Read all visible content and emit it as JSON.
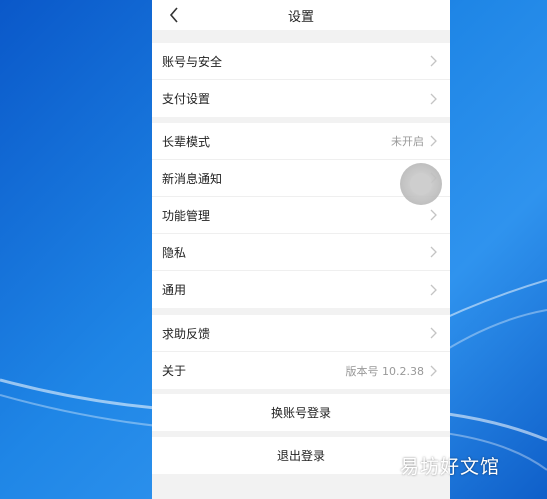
{
  "header": {
    "title": "设置"
  },
  "groups": [
    {
      "items": [
        {
          "label": "账号与安全",
          "value": ""
        },
        {
          "label": "支付设置",
          "value": ""
        }
      ]
    },
    {
      "items": [
        {
          "label": "长辈模式",
          "value": "未开启"
        },
        {
          "label": "新消息通知",
          "value": ""
        },
        {
          "label": "功能管理",
          "value": ""
        },
        {
          "label": "隐私",
          "value": ""
        },
        {
          "label": "通用",
          "value": ""
        }
      ]
    },
    {
      "items": [
        {
          "label": "求助反馈",
          "value": ""
        },
        {
          "label": "关于",
          "value": "版本号 10.2.38"
        }
      ]
    }
  ],
  "actions": {
    "switch_account": "换账号登录",
    "logout": "退出登录"
  },
  "watermark": "易坊好文馆",
  "colors": {
    "panel_bg": "#f2f2f2",
    "desktop_blue": "#1a72d6",
    "chevron": "#c4c4c4"
  }
}
